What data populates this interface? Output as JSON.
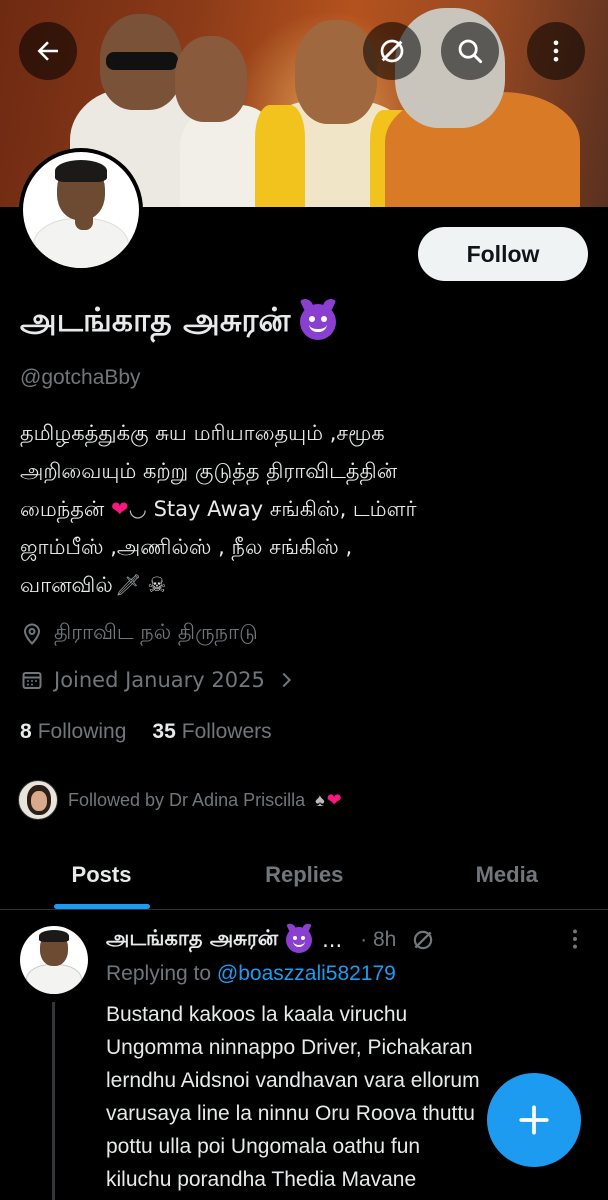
{
  "header": {
    "back_icon": "arrow-left-icon",
    "grok_icon": "grok-icon",
    "search_icon": "search-icon",
    "more_icon": "more-vertical-icon"
  },
  "profile": {
    "display_name": "அடங்காத அசுரன்",
    "name_emoji": "smiling-devil-emoji",
    "handle": "@gotchaBby",
    "follow_label": "Follow",
    "bio_lines": [
      "தமிழகத்துக்கு சுய மரியாதையும் ,சமூக",
      "அறிவையும் கற்று குடுத்த திராவிடத்தின்",
      "மைந்தன் ",
      "ஜாம்பீஸ் ,அணில்ஸ் , நீல சங்கிஸ் ,",
      "வானவில்"
    ],
    "bio_line3_suffix": " Stay Away சங்கிஸ், டம்ளர்",
    "location": "திராவிட நல் திருநாடு",
    "joined": "Joined January 2025",
    "following_count": "8",
    "following_label": "Following",
    "followers_count": "35",
    "followers_label": "Followers",
    "followed_by": "Followed by Dr Adina Priscilla"
  },
  "tabs": [
    {
      "label": "Posts",
      "active": true
    },
    {
      "label": "Replies",
      "active": false
    },
    {
      "label": "Media",
      "active": false
    }
  ],
  "post": {
    "author": "அடங்காத அசுரன்",
    "ellipsis": "...",
    "time": "· 8h",
    "replying_prefix": "Replying to ",
    "replying_handle": "@boaszzali582179",
    "text_lines": [
      "Bustand kakoos la kaala viruchu",
      "Ungomma ninnappo Driver, Pichakaran",
      "lerndhu Aidsnoi vandhavan vara ellorum",
      "varusaya line la ninnu Oru Roova thuttu",
      "pottu ulla poi Ungomala oathu fun",
      "kiluchu porandha Thedia Mavane"
    ]
  },
  "fab": {
    "icon": "plus-icon"
  },
  "colors": {
    "accent": "#1d9bf0",
    "background": "#000000",
    "secondary_text": "#71767b",
    "primary_text": "#e7e9ea"
  }
}
